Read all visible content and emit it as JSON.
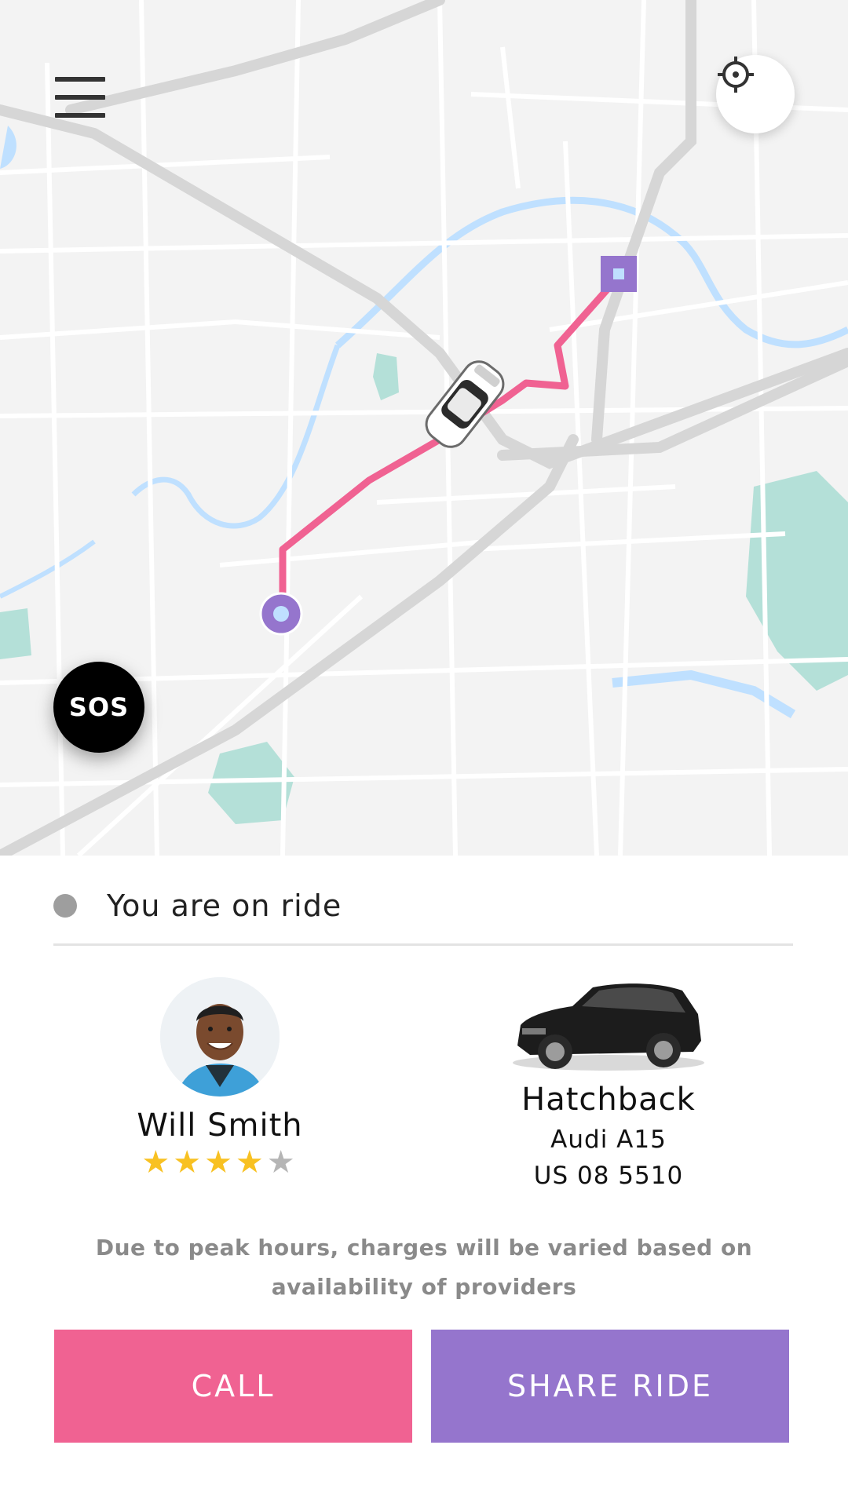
{
  "colors": {
    "route": "#f06292",
    "marker": "#9575cd",
    "call_button": "#f06292",
    "share_button": "#9575cd",
    "water": "#bfe0ff",
    "park": "#b4e0d8"
  },
  "header": {
    "menu_icon": "hamburger-menu-icon",
    "locate_icon": "crosshair-target-icon"
  },
  "map": {
    "sos_label": "SOS",
    "pickup_icon": "pickup-circle-marker",
    "dropoff_icon": "dropoff-square-marker",
    "car_icon": "car-top-view-icon"
  },
  "ride": {
    "status_text": "You are on ride"
  },
  "driver": {
    "name": "Will Smith",
    "rating": 4,
    "rating_max": 5
  },
  "vehicle": {
    "type": "Hatchback",
    "model": "Audi A15",
    "plate": "US 08 5510"
  },
  "notice": "Due to peak hours, charges will be varied based on availability of providers",
  "actions": {
    "call_label": "CALL",
    "share_label": "SHARE RIDE"
  }
}
